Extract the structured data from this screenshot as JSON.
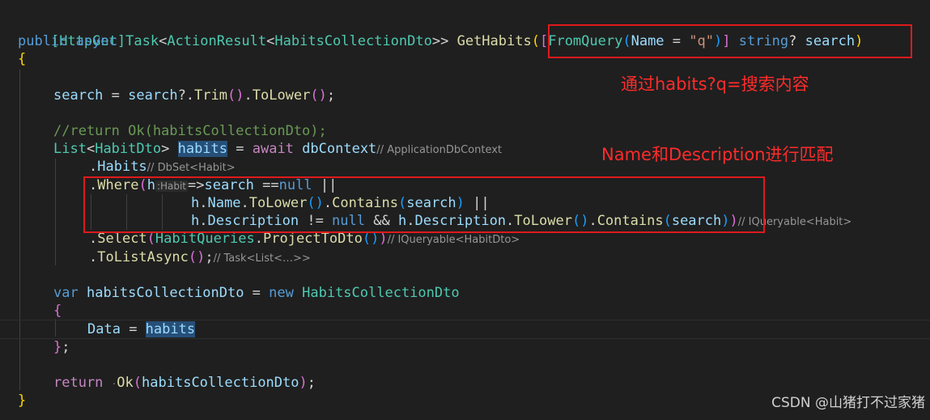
{
  "code": {
    "l1": {
      "attr": "[HttpGet]"
    },
    "l2": {
      "public": "public",
      "async": "async",
      "task": "Task",
      "lt1": "<",
      "ar": "ActionResult",
      "lt2": "<",
      "dto": "HabitsCollectionDto",
      "gt": ">>",
      "method": "GetHabits",
      "paren": "(",
      "lb": "[",
      "fq": "FromQuery",
      "p2": "(",
      "name": "Name",
      "eq": " = ",
      "q": "\"q\"",
      "p2c": ")",
      "rb": "]",
      "string": "string",
      "qm": "?",
      "search": "search",
      "pc": ")"
    },
    "l3": {
      "brace": "{"
    },
    "l5": {
      "search": "search",
      "eq": " = ",
      "search2": "search",
      "op": "?.",
      "trim": "Trim",
      "tp": "()",
      "dot": ".",
      "lower": "ToLower",
      "lp": "()",
      "semi": ";"
    },
    "l7": {
      "comment": "//return Ok(habitsCollectionDto);"
    },
    "l8": {
      "list": "List",
      "lt": "<",
      "dto": "HabitDto",
      "gt": ">",
      "habits": "habits",
      "eq": " = ",
      "await": "await",
      "ctx": "dbContext",
      "hint": "// ApplicationDbContext"
    },
    "l9": {
      "dot": ".",
      "habits": "Habits",
      "hint": "// DbSet<Habit>"
    },
    "l10": {
      "dot": ".",
      "where": "Where",
      "p": "(",
      "h": "h",
      "hint": ":Habit",
      "arrow": "=>",
      "search": "search",
      "eqnull": " ==",
      "null": "null",
      "or": " ||"
    },
    "l11": {
      "h": "h",
      "dot": ".",
      "name": "Name",
      "dot2": ".",
      "lower": "ToLower",
      "lp": "()",
      "dot3": ".",
      "contains": "Contains",
      "p": "(",
      "search": "search",
      "pc": ")",
      "or": " ||"
    },
    "l12": {
      "h": "h",
      "dot": ".",
      "desc": "Description",
      "neq": " != ",
      "null": "null",
      "and": " && ",
      "h2": "h",
      "dot2": ".",
      "desc2": "Description",
      "dot3": ".",
      "lower": "ToLower",
      "lp": "()",
      "dot4": ".",
      "contains": "Contains",
      "p": "(",
      "search": "search",
      "pc": ")",
      "pc2": ")",
      "hint": "// IQueryable<Habit>"
    },
    "l13": {
      "dot": ".",
      "select": "Select",
      "p": "(",
      "hq": "HabitQueries",
      "dot2": ".",
      "ptd": "ProjectToDto",
      "pp": "()",
      "pc": ")",
      "hint": "// IQueryable<HabitDto>"
    },
    "l14": {
      "dot": ".",
      "tla": "ToListAsync",
      "pp": "()",
      "semi": ";",
      "hint": "// Task<List<…>>"
    },
    "l16": {
      "var": "var",
      "name": "habitsCollectionDto",
      "eq": " = ",
      "new": "new",
      "type": "HabitsCollectionDto"
    },
    "l17": {
      "brace": "{"
    },
    "l18": {
      "data": "Data",
      "eq": " = ",
      "habits": "habits"
    },
    "l19": {
      "brace": "}",
      "semi": ";"
    },
    "l21": {
      "ret": "return",
      "ok": "Ok",
      "p": "(",
      "arg": "habitsCollectionDto",
      "pc": ")",
      "semi": ";"
    },
    "l22": {
      "brace": "}"
    }
  },
  "annotations": {
    "query_note": "通过habits?q=搜索内容",
    "match_note": "Name和Description进行匹配"
  },
  "watermark": "CSDN @山猪打不过家猪",
  "colors": {
    "annotation_box": "#e0191c",
    "annotation_text": "#ff2b2b",
    "editor_bg": "#1f1f1f"
  }
}
